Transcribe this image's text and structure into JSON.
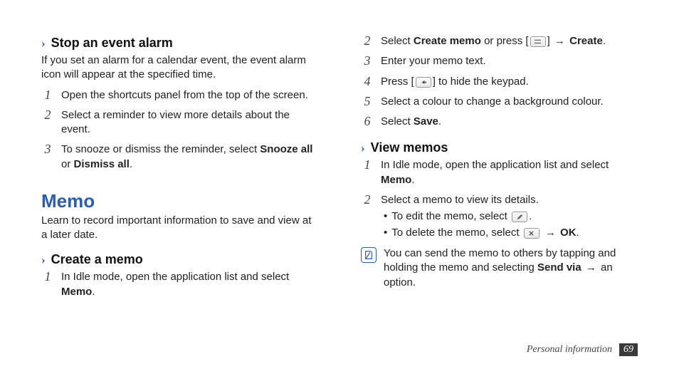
{
  "left": {
    "stopAlarm": {
      "heading": "Stop an event alarm",
      "intro": "If you set an alarm for a calendar event, the event alarm icon will appear at the specified time.",
      "steps": [
        {
          "text": "Open the shortcuts panel from the top of the screen."
        },
        {
          "text": "Select a reminder to view more details about the event."
        },
        {
          "pre": "To snooze or dismiss the reminder, select ",
          "b1": "Snooze all",
          "mid": " or ",
          "b2": "Dismiss all",
          "post": "."
        }
      ]
    },
    "memo": {
      "title": "Memo",
      "intro": "Learn to record important information to save and view at a later date."
    },
    "createMemo": {
      "heading": "Create a memo",
      "step1_pre": "In Idle mode, open the application list and select ",
      "step1_b": "Memo",
      "step1_post": "."
    }
  },
  "right": {
    "createCont": {
      "s2_pre": "Select ",
      "s2_b1": "Create memo",
      "s2_mid": " or press [",
      "s2_arrow": " → ",
      "s2_b2": "Create",
      "s2_post": ".",
      "s3": "Enter your memo text.",
      "s4_pre": "Press [",
      "s4_post": "] to hide the keypad.",
      "s5": "Select a colour to change a background colour.",
      "s6_pre": "Select ",
      "s6_b": "Save",
      "s6_post": "."
    },
    "viewMemos": {
      "heading": "View memos",
      "s1_pre": "In Idle mode, open the application list and select ",
      "s1_b": "Memo",
      "s1_post": ".",
      "s2": "Select a memo to view its details.",
      "b1_pre": "To edit the memo, select ",
      "b1_post": ".",
      "b2_pre": "To delete the memo, select ",
      "b2_arrow": " → ",
      "b2_b": "OK",
      "b2_post": ".",
      "note_pre": "You can send the memo to others by tapping and holding the memo and selecting ",
      "note_b": "Send via",
      "note_arrow": " → ",
      "note_post": "an option."
    }
  },
  "footer": {
    "section": "Personal information",
    "page": "69"
  },
  "icons": {
    "menu": "menu-icon",
    "back": "back-icon",
    "pencil": "pencil-icon",
    "close": "close-icon",
    "note": "note-icon"
  }
}
